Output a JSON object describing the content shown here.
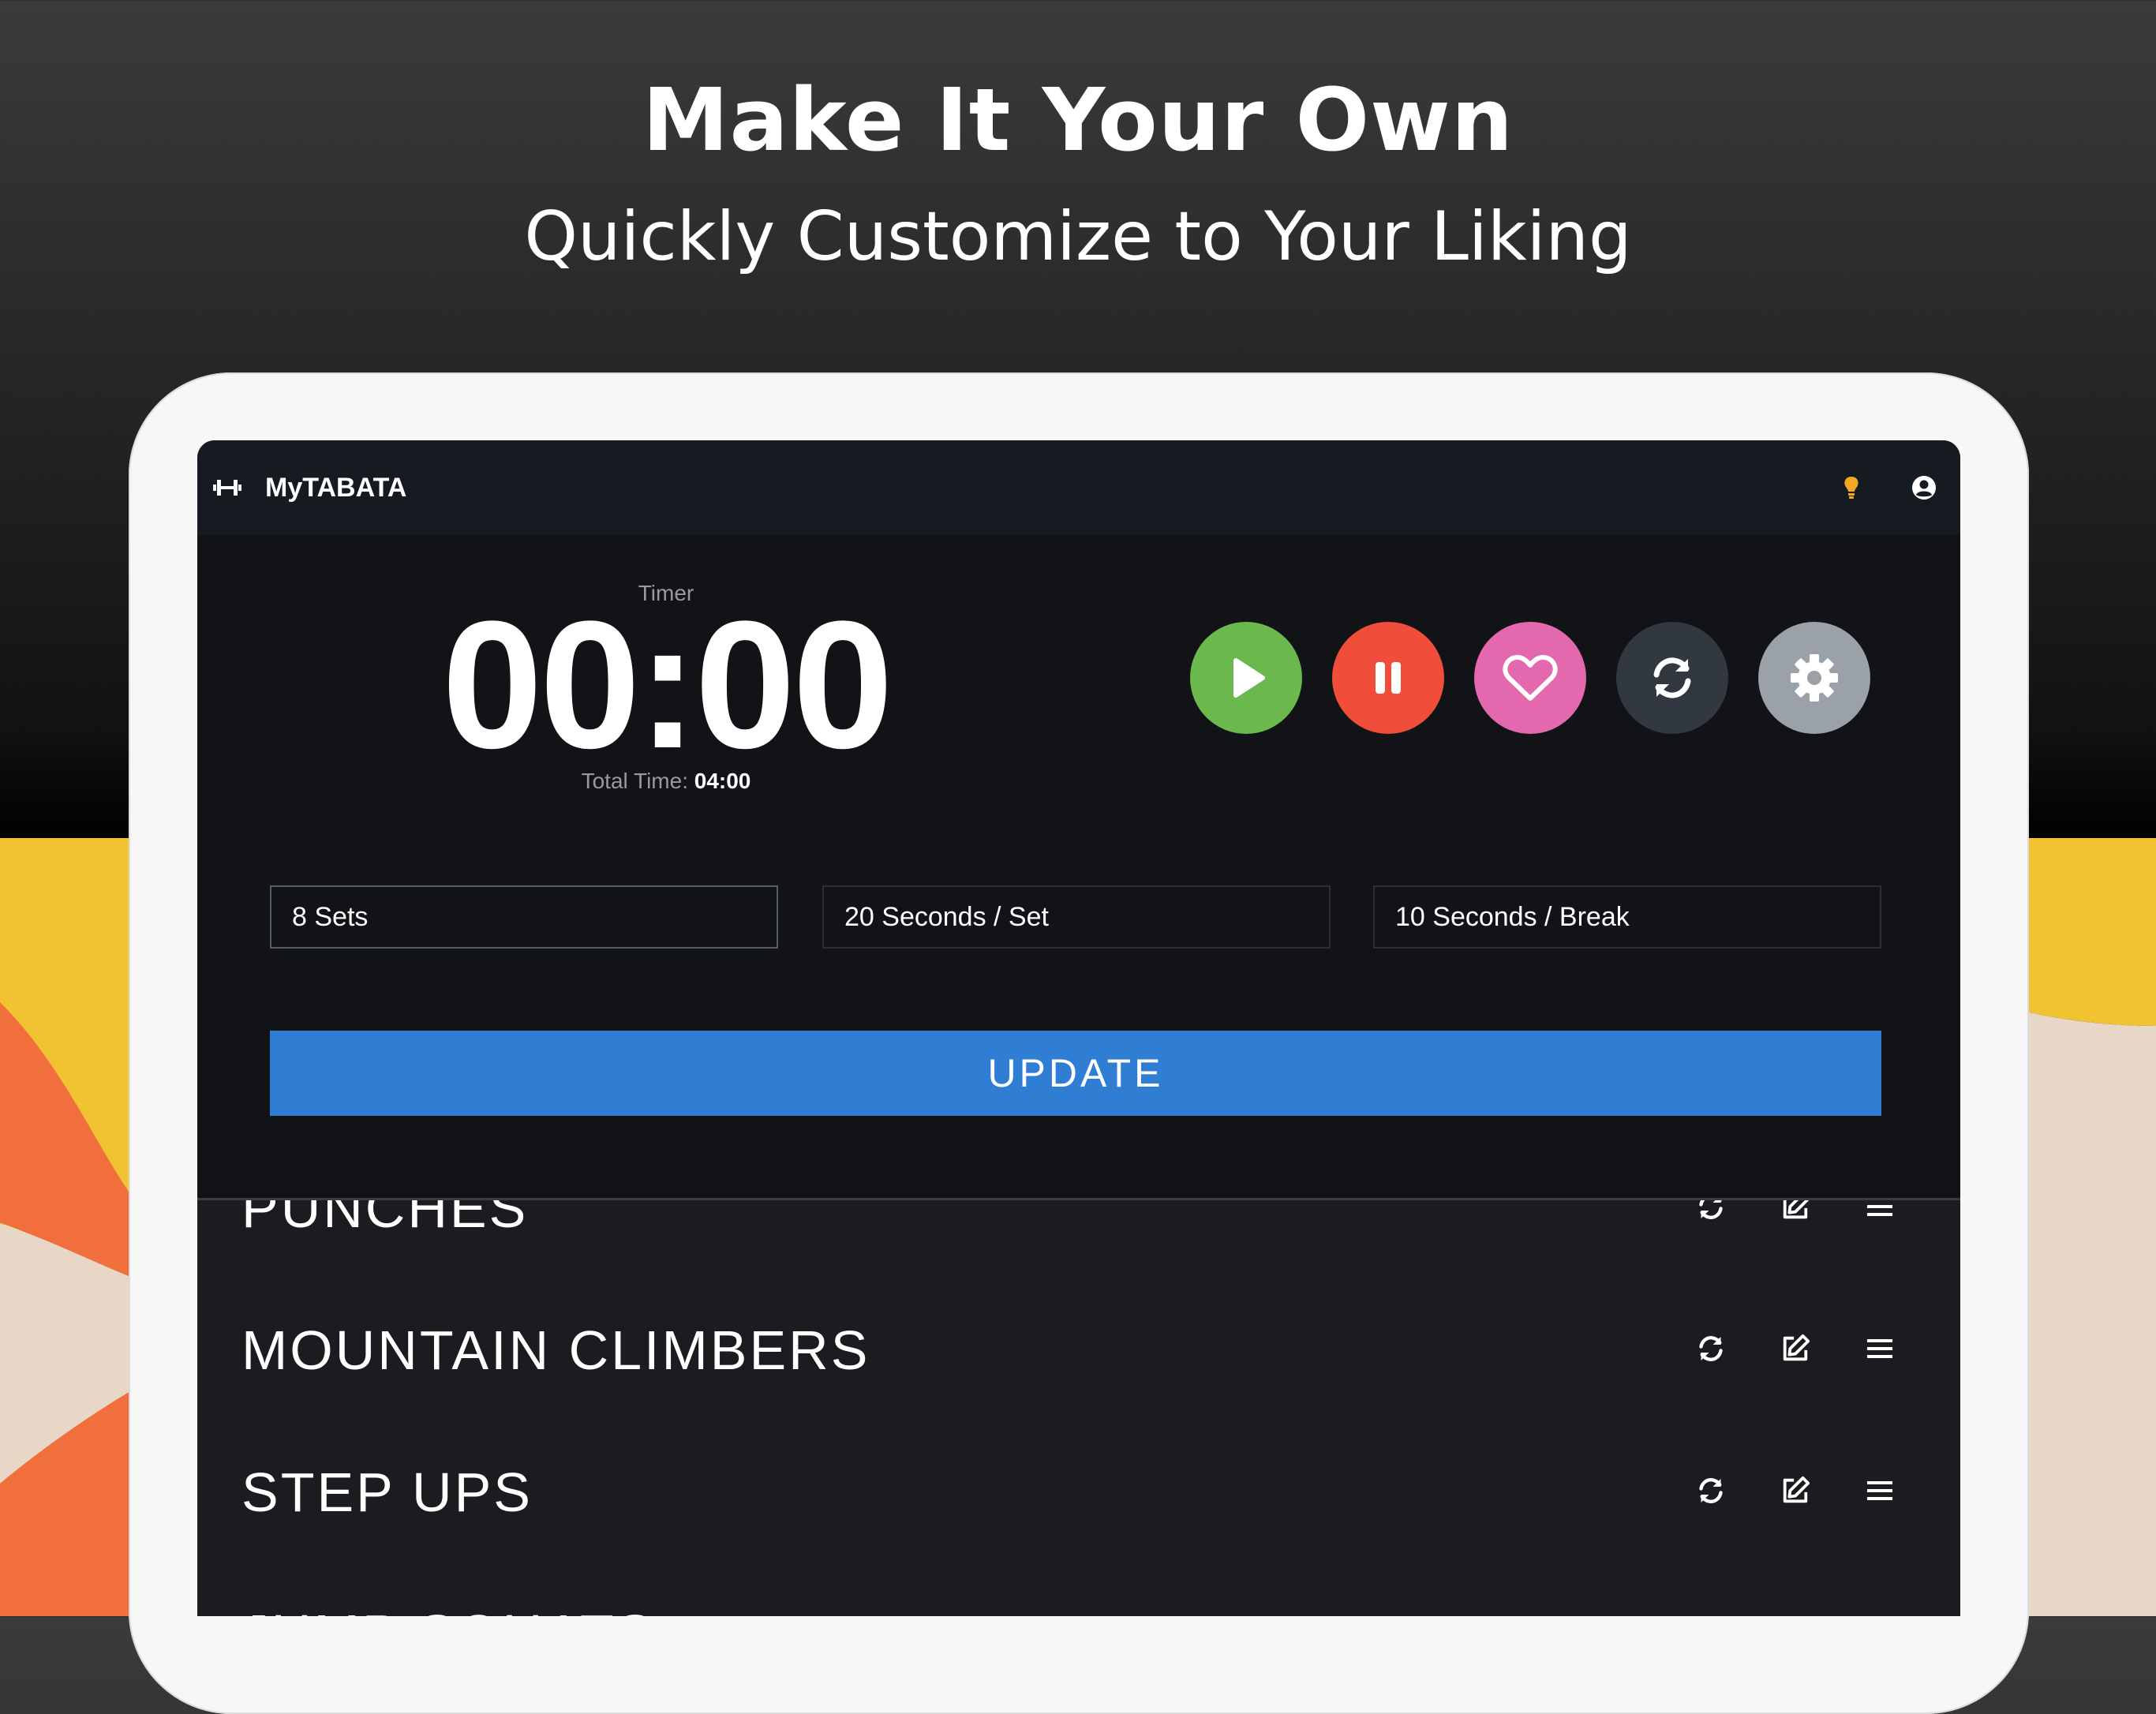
{
  "promo": {
    "title": "Make It Your Own",
    "subtitle": "Quickly Customize to Your Liking"
  },
  "colors": {
    "accent_yellow": "#f1c232",
    "accent_orange": "#f06f3c",
    "accent_beige": "#e8d6c6",
    "update_blue": "#307dd4",
    "play_green": "#6bb84d",
    "pause_red": "#f04d3a",
    "fav_pink": "#e468ad",
    "reset_dark": "#323840",
    "settings_gray": "#9aa1a8"
  },
  "appbar": {
    "logo_icon": "dumbbell-icon",
    "title": "MyTABATA",
    "icons": [
      "lightbulb-icon",
      "account-circle-icon"
    ]
  },
  "timer": {
    "label": "Timer",
    "value": "00:00",
    "total_label": "Total Time:",
    "total_value": "04:00"
  },
  "controls": [
    "play-icon",
    "pause-icon",
    "heart-icon",
    "refresh-icon",
    "gear-icon"
  ],
  "settings": {
    "sets": "8 Sets",
    "work": "20 Seconds / Set",
    "rest": "10 Seconds / Break"
  },
  "update_label": "UPDATE",
  "exercises": [
    {
      "name": "PUNCHES"
    },
    {
      "name": "MOUNTAIN CLIMBERS"
    },
    {
      "name": "STEP UPS"
    },
    {
      "name": "JUMP SQUATS"
    }
  ],
  "row_icons": [
    "refresh-icon",
    "edit-icon",
    "drag-handle-icon"
  ]
}
